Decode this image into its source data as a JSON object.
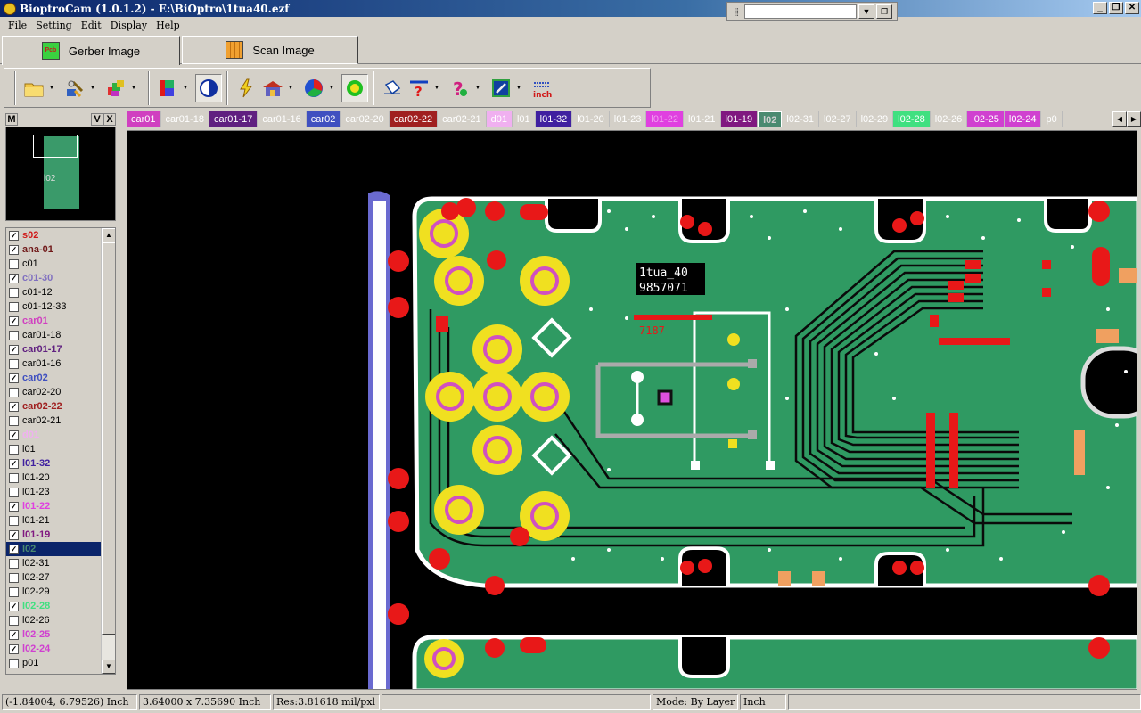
{
  "window": {
    "title": "BioptroCam (1.0.1.2) - E:\\BiOptro\\1tua40.ezf",
    "combo_value": ""
  },
  "menu": [
    "File",
    "Setting",
    "Edit",
    "Display",
    "Help"
  ],
  "main_tabs": [
    {
      "label": "Gerber Image",
      "icon_text": "Pcb",
      "icon": "pcb-icon",
      "active": true
    },
    {
      "label": "Scan Image",
      "icon_text": "",
      "icon": "scan-grid-icon",
      "active": false
    }
  ],
  "toolbar": {
    "buttons": [
      "open-folder-icon",
      "tools-icon",
      "layers-stack-icon",
      "color-palette-icon",
      "contrast-icon",
      "flash-icon",
      "house-icon",
      "color-wheel-icon",
      "green-dot-icon",
      "erase-icon",
      "measure-help-icon",
      "question-color-icon",
      "edit-icon",
      "units-inch-icon"
    ]
  },
  "panel": {
    "m_label": "M",
    "v_label": "V",
    "x_label": "X",
    "minimap_label": "l02"
  },
  "layers": [
    {
      "name": "s02",
      "checked": true,
      "color": "#d01818",
      "bold": true
    },
    {
      "name": "ana-01",
      "checked": true,
      "color": "#701818",
      "bold": true
    },
    {
      "name": "c01",
      "checked": false,
      "color": "#000000",
      "bold": false
    },
    {
      "name": "c01-30",
      "checked": true,
      "color": "#8070c0",
      "bold": true
    },
    {
      "name": "c01-12",
      "checked": false,
      "color": "#000000",
      "bold": false
    },
    {
      "name": "c01-12-33",
      "checked": false,
      "color": "#000000",
      "bold": false
    },
    {
      "name": "car01",
      "checked": true,
      "color": "#d040c0",
      "bold": true
    },
    {
      "name": "car01-18",
      "checked": false,
      "color": "#000000",
      "bold": false
    },
    {
      "name": "car01-17",
      "checked": true,
      "color": "#602080",
      "bold": true
    },
    {
      "name": "car01-16",
      "checked": false,
      "color": "#000000",
      "bold": false
    },
    {
      "name": "car02",
      "checked": true,
      "color": "#4050c0",
      "bold": true
    },
    {
      "name": "car02-20",
      "checked": false,
      "color": "#000000",
      "bold": false
    },
    {
      "name": "car02-22",
      "checked": true,
      "color": "#a02020",
      "bold": true
    },
    {
      "name": "car02-21",
      "checked": false,
      "color": "#000000",
      "bold": false
    },
    {
      "name": "d01",
      "checked": true,
      "color": "#f0b0f0",
      "bold": true
    },
    {
      "name": "l01",
      "checked": false,
      "color": "#000000",
      "bold": false
    },
    {
      "name": "l01-32",
      "checked": true,
      "color": "#4020a0",
      "bold": true
    },
    {
      "name": "l01-20",
      "checked": false,
      "color": "#000000",
      "bold": false
    },
    {
      "name": "l01-23",
      "checked": false,
      "color": "#000000",
      "bold": false
    },
    {
      "name": "l01-22",
      "checked": true,
      "color": "#e040e0",
      "bold": true
    },
    {
      "name": "l01-21",
      "checked": false,
      "color": "#000000",
      "bold": false
    },
    {
      "name": "l01-19",
      "checked": true,
      "color": "#801880",
      "bold": true
    },
    {
      "name": "l02",
      "checked": true,
      "color": "#4a8a70",
      "bold": true,
      "selected": true
    },
    {
      "name": "l02-31",
      "checked": false,
      "color": "#000000",
      "bold": false
    },
    {
      "name": "l02-27",
      "checked": false,
      "color": "#000000",
      "bold": false
    },
    {
      "name": "l02-29",
      "checked": false,
      "color": "#000000",
      "bold": false
    },
    {
      "name": "l02-28",
      "checked": true,
      "color": "#40e080",
      "bold": true
    },
    {
      "name": "l02-26",
      "checked": false,
      "color": "#000000",
      "bold": false
    },
    {
      "name": "l02-25",
      "checked": true,
      "color": "#d040d0",
      "bold": true
    },
    {
      "name": "l02-24",
      "checked": true,
      "color": "#d040d0",
      "bold": true
    },
    {
      "name": "p01",
      "checked": false,
      "color": "#000000",
      "bold": false
    }
  ],
  "layer_tabs": [
    {
      "name": "car01",
      "bg": "#d040c0",
      "fg": "#ffffff"
    },
    {
      "name": "car01-18",
      "bg": "#d4d0c8",
      "fg": "#ffffff"
    },
    {
      "name": "car01-17",
      "bg": "#602080",
      "fg": "#ffffff"
    },
    {
      "name": "car01-16",
      "bg": "#d4d0c8",
      "fg": "#ffffff"
    },
    {
      "name": "car02",
      "bg": "#4050c0",
      "fg": "#ffffff"
    },
    {
      "name": "car02-20",
      "bg": "#d4d0c8",
      "fg": "#ffffff"
    },
    {
      "name": "car02-22",
      "bg": "#a02020",
      "fg": "#ffffff"
    },
    {
      "name": "car02-21",
      "bg": "#d4d0c8",
      "fg": "#ffffff"
    },
    {
      "name": "d01",
      "bg": "#f0b0f0",
      "fg": "#ffffff"
    },
    {
      "name": "l01",
      "bg": "#d4d0c8",
      "fg": "#ffffff"
    },
    {
      "name": "l01-32",
      "bg": "#4020a0",
      "fg": "#ffffff"
    },
    {
      "name": "l01-20",
      "bg": "#d4d0c8",
      "fg": "#ffffff"
    },
    {
      "name": "l01-23",
      "bg": "#d4d0c8",
      "fg": "#ffffff"
    },
    {
      "name": "l01-22",
      "bg": "#e040e0",
      "fg": "#f0a0f0"
    },
    {
      "name": "l01-21",
      "bg": "#d4d0c8",
      "fg": "#ffffff"
    },
    {
      "name": "l01-19",
      "bg": "#801880",
      "fg": "#ffffff"
    },
    {
      "name": "l02",
      "bg": "#4a8a70",
      "fg": "#d0d0d0"
    },
    {
      "name": "l02-31",
      "bg": "#d4d0c8",
      "fg": "#ffffff"
    },
    {
      "name": "l02-27",
      "bg": "#d4d0c8",
      "fg": "#ffffff"
    },
    {
      "name": "l02-29",
      "bg": "#d4d0c8",
      "fg": "#ffffff"
    },
    {
      "name": "l02-28",
      "bg": "#40e080",
      "fg": "#ffffff"
    },
    {
      "name": "l02-26",
      "bg": "#d4d0c8",
      "fg": "#ffffff"
    },
    {
      "name": "l02-25",
      "bg": "#d040d0",
      "fg": "#ffffff"
    },
    {
      "name": "l02-24",
      "bg": "#d040d0",
      "fg": "#ffffff"
    },
    {
      "name": "p0",
      "bg": "#d4d0c8",
      "fg": "#ffffff"
    }
  ],
  "board": {
    "label_line1": "1tua_40",
    "label_line2": "9857071",
    "small_text": "7187"
  },
  "status": {
    "cursor": "(-1.84004, 6.79526) Inch",
    "size": "3.64000 x 7.35690 Inch",
    "res": "Res:3.81618 mil/pxl",
    "blank": "",
    "mode": "Mode: By Layer",
    "units": "Inch"
  },
  "colors": {
    "board": "#2f9a62",
    "copper_pad": "#f0e020",
    "via": "#e81818",
    "outline": "#ffffff",
    "trace": "#0a0a0a"
  }
}
